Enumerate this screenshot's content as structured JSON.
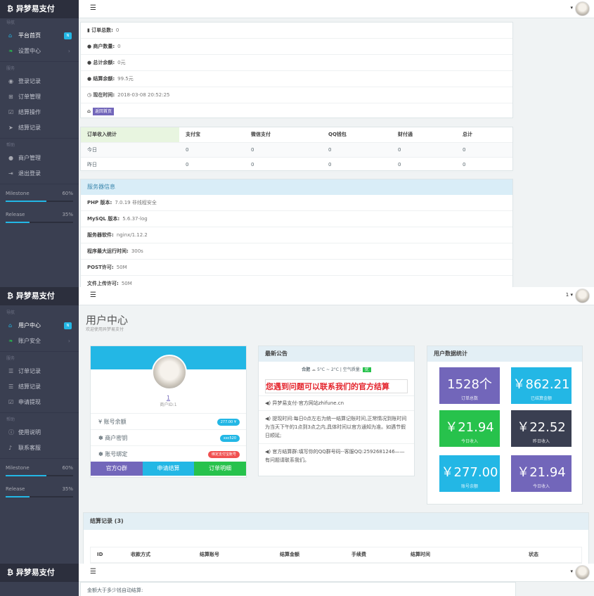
{
  "brand": "异梦易支付",
  "colors": {
    "sidebar": "#3a3f51",
    "accent": "#23b7e5",
    "purple": "#7266ba",
    "green": "#27c24c",
    "dark": "#3a3f51"
  },
  "s1": {
    "groups": [
      "导航",
      "服务",
      "帮助"
    ],
    "nav": [
      {
        "icon": "home-icon",
        "label": "平台首页",
        "badge": "N"
      },
      {
        "icon": "leaf-icon",
        "label": "设置中心"
      }
    ],
    "service": [
      {
        "icon": "camera-icon",
        "label": "登录记录"
      },
      {
        "icon": "cart-icon",
        "label": "订单管理"
      },
      {
        "icon": "check-icon",
        "label": "结算操作"
      },
      {
        "icon": "send-icon",
        "label": "结算记录"
      }
    ],
    "help": [
      {
        "icon": "user-icon",
        "label": "商户管理"
      },
      {
        "icon": "logout-icon",
        "label": "退出登录"
      }
    ],
    "milestone": {
      "label": "Milestone",
      "pct": "60%",
      "value": 60
    },
    "release": {
      "label": "Release",
      "pct": "35%",
      "value": 35
    },
    "stats": [
      {
        "label": "订单总数:",
        "value": "0"
      },
      {
        "label": "商户数量:",
        "value": "0"
      },
      {
        "label": "总计余额:",
        "value": "0元"
      },
      {
        "label": "结算余额:",
        "value": "99.5元"
      },
      {
        "label": "现在时间:",
        "value": "2018-03-08 20:52:25"
      }
    ],
    "back_button": "返回首页",
    "orders": {
      "headers": [
        "订单收入统计",
        "支付宝",
        "微信支付",
        "QQ钱包",
        "财付通",
        "总计"
      ],
      "rows": [
        [
          "今日",
          "0",
          "0",
          "0",
          "0",
          "0"
        ],
        [
          "昨日",
          "0",
          "0",
          "0",
          "0",
          "0"
        ]
      ]
    },
    "server": {
      "title": "服务器信息",
      "rows": [
        {
          "label": "PHP 版本:",
          "value": "7.0.19 非线程安全"
        },
        {
          "label": "MySQL 版本:",
          "value": "5.6.37-log"
        },
        {
          "label": "服务器软件:",
          "value": "nginx/1.12.2"
        },
        {
          "label": "程序最大运行时间:",
          "value": "300s"
        },
        {
          "label": "POST许可:",
          "value": "50M"
        },
        {
          "label": "文件上传许可:",
          "value": "50M"
        }
      ]
    }
  },
  "s2": {
    "user_menu": "1 ▾",
    "nav": [
      {
        "icon": "home-icon",
        "label": "用户中心",
        "badge": "N"
      },
      {
        "icon": "leaf-icon",
        "label": "账户安全"
      }
    ],
    "service": [
      {
        "icon": "list-icon",
        "label": "订单记录"
      },
      {
        "icon": "list-icon",
        "label": "结算记录"
      },
      {
        "icon": "check-icon",
        "label": "申请提现"
      }
    ],
    "help": [
      {
        "icon": "info-icon",
        "label": "使用说明"
      },
      {
        "icon": "bell-icon",
        "label": "联系客服"
      }
    ],
    "page_title": "用户中心",
    "page_subtitle": "欢迎使用异梦易支付",
    "profile": {
      "uid": "1",
      "uid_label": "商户ID:1",
      "rows": [
        {
          "label": "¥ 账号余额",
          "badge": "277.00 ¥",
          "color": "#23b7e5"
        },
        {
          "label": "✽ 商户密钥",
          "badge": "xxc520",
          "color": "#23b7e5"
        },
        {
          "label": "✽ 账号绑定",
          "badge": "绑定支付宝账号",
          "color": "#f05050"
        }
      ],
      "buttons": [
        {
          "label": "官方Q群",
          "color": "#7266ba"
        },
        {
          "label": "申请结算",
          "color": "#23b7e5"
        },
        {
          "label": "订单明细",
          "color": "#27c24c"
        }
      ]
    },
    "notice": {
      "title": "最新公告",
      "weather_city": "合肥",
      "weather": "5°C ~ 2°C  |  空气质量:",
      "aqi": "优",
      "banner": "您遇到问题可以联系我们的官方结算",
      "items": [
        "◀) 异梦易支付-官方网站zhifune.cn",
        "◀) 提现时间:每日0点左右为统一结算记账时间,正常情况到账时间为当天下午的1点到3点之内,具体时间以官方通知为准。如遇节假日顺延;",
        "◀) 官方结算群:填写你的QQ群号码--客服QQ:2592681246——有问题请联系我们。"
      ]
    },
    "datastats": {
      "title": "用户数据统计",
      "tiles": [
        {
          "num": "1528个",
          "cap": "订单总数",
          "color": "#7266ba"
        },
        {
          "num": "￥862.21",
          "cap": "已结算金额",
          "color": "#23b7e5"
        },
        {
          "num": "￥21.94",
          "cap": "今日收入",
          "color": "#27c24c"
        },
        {
          "num": "￥22.52",
          "cap": "昨日收入",
          "color": "#3a3f51"
        },
        {
          "num": "￥277.00",
          "cap": "账号余额",
          "color": "#23b7e5"
        },
        {
          "num": "￥21.94",
          "cap": "今日收入",
          "color": "#7266ba"
        }
      ]
    },
    "settle": {
      "title": "结算记录 (3)",
      "headers": [
        "ID",
        "收款方式",
        "结算账号",
        "结算金额",
        "手续费",
        "结算时间",
        "状态"
      ]
    }
  },
  "s3": {
    "notice_text": "金额大于多少钱自动结算:"
  }
}
